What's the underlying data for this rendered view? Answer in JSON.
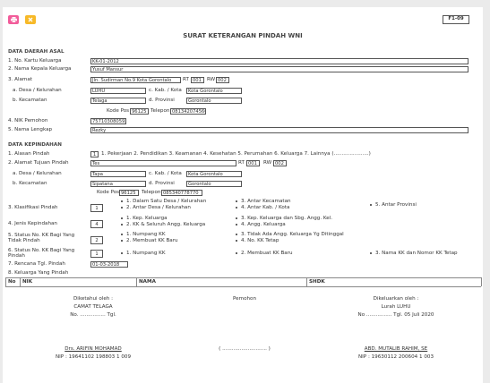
{
  "colors": {
    "print_button": "#f25c9a",
    "close_button": "#f7b928"
  },
  "toolbar": {
    "print_icon": "printer-icon",
    "close_icon": "close-icon"
  },
  "form_code": "F1-09",
  "title": "SURAT KETERANGAN PINDAH WNI",
  "asal": {
    "heading": "DATA DAERAH ASAL",
    "no_kk_label": "1. No. Kartu Keluarga",
    "no_kk": "KK-01-2012",
    "kepala_label": "2. Nama Kepala Keluarga",
    "kepala": "Yusuf Mansur",
    "alamat_label": "3. Alamat",
    "alamat": "Jln. Sudirman No.9 Kota Gorontalo",
    "rt_label": "RT",
    "rt": "001",
    "rw_label": "RW",
    "rw": "002",
    "desa_label": "a. Desa / Kelurahan",
    "desa": "LUHU",
    "kab_label": "c. Kab. / Kota",
    "kab": "Kota Gorontalo",
    "kec_label": "b. Kecamatan",
    "kec": "Telaga",
    "prov_label": "d. Provinsi",
    "prov": "Gorontalo",
    "kodepos_label": "Kode Pos",
    "kodepos": "96125",
    "telepon_label": "Telepon",
    "telepon": "081342074566",
    "nik_label": "4. NIK Pemohon",
    "nik": "7571030805920001",
    "nama_label": "5. Nama Lengkap",
    "nama": "Rezky"
  },
  "kepindahan": {
    "heading": "DATA KEPINDAHAN",
    "alasan_label": "1. Alasan Pindah",
    "alasan": "1",
    "alasan_options": "1. Pekerjaan 2. Pendidikan 3. Keamanan 4. Kesehatan 5. Perumahan 6. Keluarga 7. Lainnya (......................)",
    "tujuan_label": "2. Alamat Tujuan Pindah",
    "tujuan": "Tes",
    "rt_label": "RT",
    "rt": "001",
    "rw_label": "RW",
    "rw": "002",
    "desa_label": "a. Desa / Kelurahan",
    "desa": "Tapa",
    "kab_label": "c. Kab. / Kota",
    "kab": "Kota Gorontalo",
    "kec_label": "b. Kecamatan",
    "kec": "Sipatana",
    "prov_label": "d. Provinsi",
    "prov": "Gorontalo",
    "kodepos_label": "Kode Pos",
    "kodepos": "96125",
    "telepon_label": "Telepon",
    "telepon": "085340778770",
    "klasifikasi_label": "3. Klasifikasi Pindah",
    "klasifikasi": "1",
    "klasifikasi_opts": [
      "1. Dalam Satu Desa / Kelurahan",
      "2. Antar Desa / Kelurahan",
      "3. Antar Kecamatan",
      "4. Antar Kab. / Kota",
      "5. Antar Provinsi"
    ],
    "jenis_label": "4. Jenis Kepindahan",
    "jenis": "4",
    "jenis_opts": [
      "1. Kep. Keluarga",
      "2. KK & Seluruh Angg. Keluarga",
      "3. Kep. Keluarga dan Sbg. Angg. Kel.",
      "4. Angg. Keluarga"
    ],
    "status_tidak_label": "5. Status No. KK Bagi Yang Tidak Pindah",
    "status_tidak": "2",
    "status_tidak_opts": [
      "1. Numpang KK",
      "2. Membuat KK Baru",
      "3. Tidak Ada Angg. Keluarga Yg Ditinggal",
      "4. No. KK Tetap"
    ],
    "status_pindah_label": "6. Status No. KK Bagi Yang Pindah",
    "status_pindah": "1",
    "status_pindah_opts": [
      "1. Numpang KK",
      "2. Membuat KK Baru",
      "3. Nama KK dan Nomor KK Tetap"
    ],
    "rencana_label": "7. Rencana Tgl. Pindah",
    "rencana": "01-03-2018",
    "keluarga_label": "8. Keluarga Yang Pindah"
  },
  "table": {
    "headers": [
      "No",
      "NIK",
      "NAMA",
      "SHDK"
    ]
  },
  "signatures": {
    "left_known": "Diketahui oleh :",
    "left_title": "CAMAT TELAGA",
    "left_no": "No. ................ Tgl.",
    "middle_title": "Pemohon",
    "right_issued": "Dikeluarkan oleh :",
    "right_title": "Lurah LUHU",
    "right_no": "No ................ Tgl. 05 Juli 2020",
    "left_name": "Drs. ARIFIN MOHAMAD",
    "left_nip": "NIP : 19641102 198803 1 009",
    "middle_name": "( ............................ )",
    "right_name": "ABD. MUTALIB RAHIM, SE",
    "right_nip": "NIP : 19630112 200604 1 003"
  }
}
